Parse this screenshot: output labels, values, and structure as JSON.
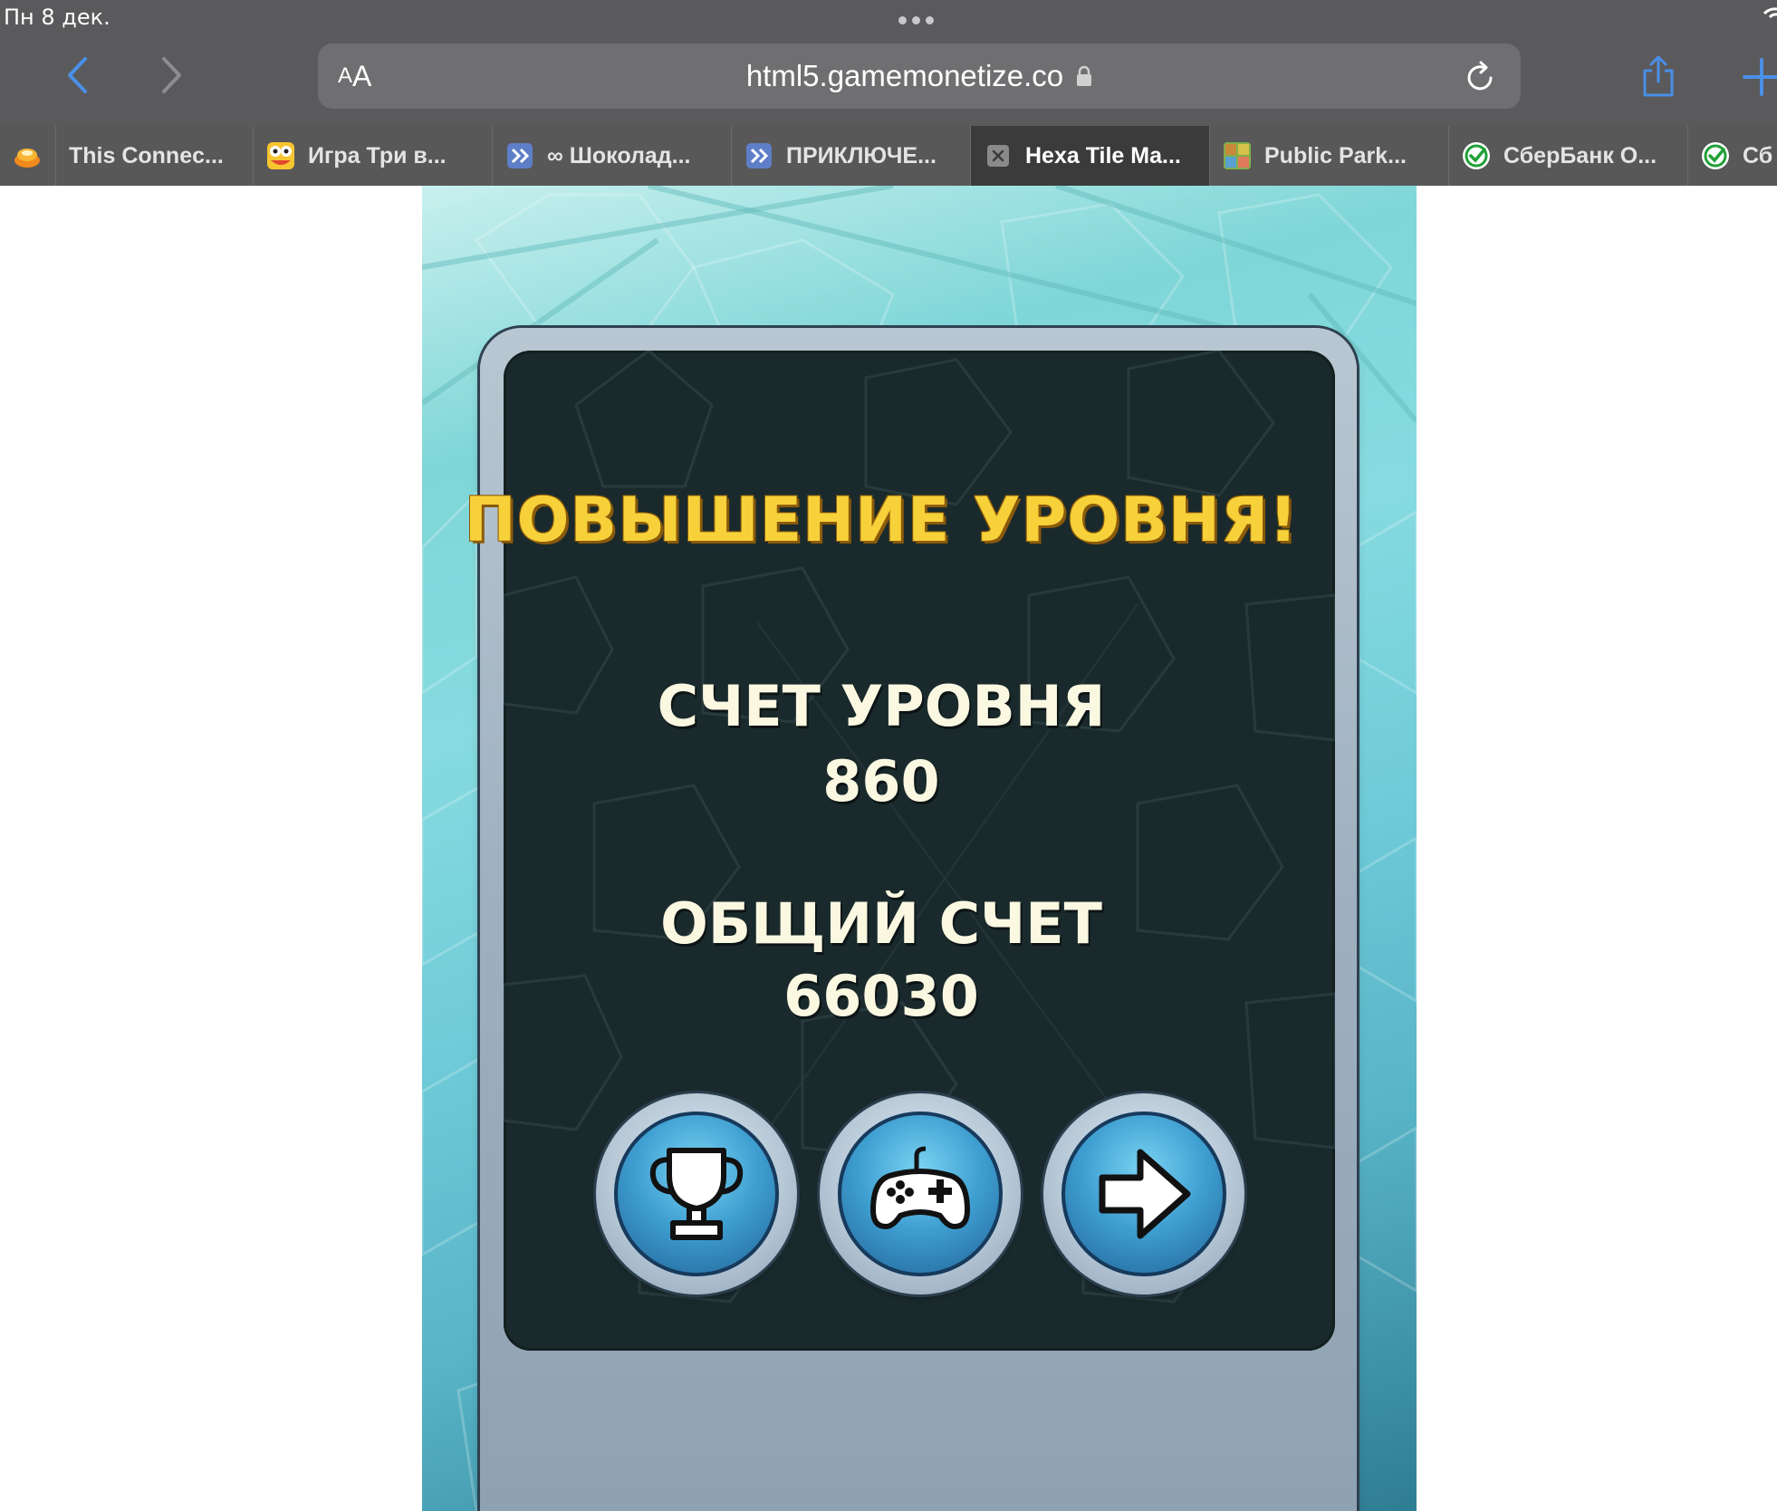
{
  "status_bar": {
    "date": "Пн 8 дек."
  },
  "browser": {
    "aa_small": "A",
    "aa_big": "A",
    "url": "html5.gamemonetize.co"
  },
  "tabs": [
    {
      "label": "",
      "icon": "orange-bowl-icon",
      "active": false
    },
    {
      "label": "This Connec...",
      "icon": "",
      "active": false
    },
    {
      "label": "Игра Три в...",
      "icon": "frog-face-icon",
      "active": false
    },
    {
      "label": "∞ Шоколад...",
      "icon": "puzzle-game-icon",
      "active": false
    },
    {
      "label": "ПРИКЛЮЧЕ...",
      "icon": "puzzle-game-icon",
      "active": false
    },
    {
      "label": "Hexa Tile Ma...",
      "icon": "close-tab-icon",
      "active": true
    },
    {
      "label": "Public Park...",
      "icon": "park-game-icon",
      "active": false
    },
    {
      "label": "СберБанк О...",
      "icon": "sberbank-icon",
      "active": false
    },
    {
      "label": "Сб",
      "icon": "sberbank-icon",
      "active": false
    }
  ],
  "game": {
    "title": "ПОВЫШЕНИЕ УРОВНЯ!",
    "level_score_label": "СЧЕТ УРОВНЯ",
    "level_score_value": "860",
    "total_score_label": "ОБЩИЙ СЧЕТ",
    "total_score_value": "66030",
    "buttons": [
      "trophy-icon",
      "gamepad-icon",
      "arrow-right-icon"
    ]
  },
  "colors": {
    "chrome": "#5a5a5c",
    "accent_blue": "#4a8fe8",
    "title_yellow": "#f7d13a",
    "panel_dark": "#1a2a2c"
  }
}
